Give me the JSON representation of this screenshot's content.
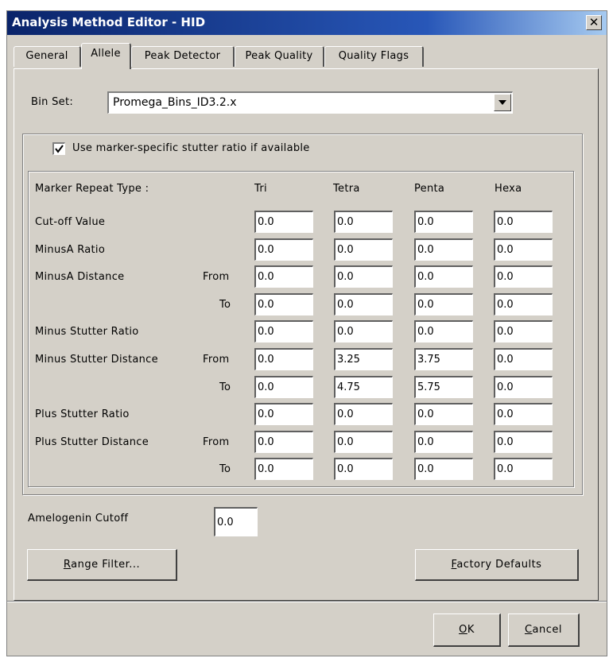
{
  "window": {
    "title": "Analysis Method Editor - HID",
    "close_glyph": "✕"
  },
  "tabs": [
    {
      "label": "General"
    },
    {
      "label": "Allele"
    },
    {
      "label": "Peak Detector"
    },
    {
      "label": "Peak Quality"
    },
    {
      "label": "Quality Flags"
    }
  ],
  "active_tab": "Allele",
  "bin_set": {
    "label": "Bin Set:",
    "value": "Promega_Bins_ID3.2.x"
  },
  "stutter": {
    "checkbox_label": "Use marker-specific stutter ratio if available",
    "checked": true,
    "header_label": "Marker Repeat Type :",
    "columns": [
      "Tri",
      "Tetra",
      "Penta",
      "Hexa"
    ],
    "rows": [
      {
        "label": "Cut-off Value",
        "sublabel": "",
        "values": [
          "0.0",
          "0.0",
          "0.0",
          "0.0"
        ]
      },
      {
        "label": "MinusA Ratio",
        "sublabel": "",
        "values": [
          "0.0",
          "0.0",
          "0.0",
          "0.0"
        ]
      },
      {
        "label": "MinusA Distance",
        "sublabel": "From",
        "values": [
          "0.0",
          "0.0",
          "0.0",
          "0.0"
        ]
      },
      {
        "label": "",
        "sublabel": "To",
        "values": [
          "0.0",
          "0.0",
          "0.0",
          "0.0"
        ]
      },
      {
        "label": "Minus Stutter Ratio",
        "sublabel": "",
        "values": [
          "0.0",
          "0.0",
          "0.0",
          "0.0"
        ]
      },
      {
        "label": "Minus Stutter Distance",
        "sublabel": "From",
        "values": [
          "0.0",
          "3.25",
          "3.75",
          "0.0"
        ]
      },
      {
        "label": "",
        "sublabel": "To",
        "values": [
          "0.0",
          "4.75",
          "5.75",
          "0.0"
        ]
      },
      {
        "label": "Plus Stutter Ratio",
        "sublabel": "",
        "values": [
          "0.0",
          "0.0",
          "0.0",
          "0.0"
        ]
      },
      {
        "label": "Plus Stutter Distance",
        "sublabel": "From",
        "values": [
          "0.0",
          "0.0",
          "0.0",
          "0.0"
        ]
      },
      {
        "label": "",
        "sublabel": "To",
        "values": [
          "0.0",
          "0.0",
          "0.0",
          "0.0"
        ]
      }
    ]
  },
  "amelogenin": {
    "label": "Amelogenin Cutoff",
    "value": "0.0"
  },
  "buttons": {
    "range_filter_mnemonic": "R",
    "range_filter_rest": "ange Filter...",
    "factory_defaults_mnemonic": "F",
    "factory_defaults_rest": "actory Defaults",
    "ok_mnemonic": "O",
    "ok_rest": "K",
    "cancel_mnemonic": "C",
    "cancel_rest": "ancel"
  },
  "icons": {
    "dropdown": "chevron-down-icon",
    "check": "check-icon"
  },
  "colors": {
    "title_bar_start": "#0a246a",
    "title_bar_end": "#a6caf0",
    "face": "#d4d0c8"
  }
}
